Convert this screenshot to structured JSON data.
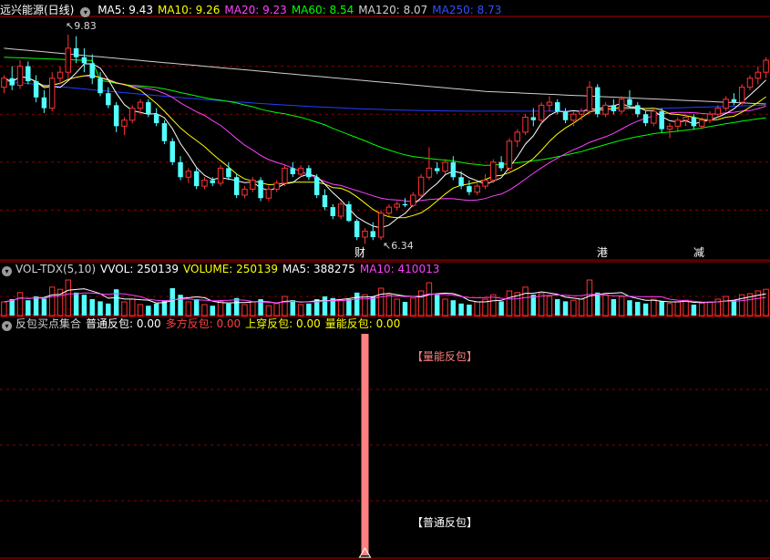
{
  "main_header": {
    "stock_title": "远兴能源(日线)",
    "indicators": [
      {
        "label": "MA5: 9.43",
        "color": "#ffffff"
      },
      {
        "label": "MA10: 9.26",
        "color": "#ffff00"
      },
      {
        "label": "MA20: 9.23",
        "color": "#ff40ff"
      },
      {
        "label": "MA60: 8.54",
        "color": "#00ff00"
      },
      {
        "label": "MA120: 8.07",
        "color": "#d0d0d0"
      },
      {
        "label": "MA250: 8.73",
        "color": "#3050ff"
      }
    ]
  },
  "vol_header": {
    "indicators": [
      {
        "label": "VOL-TDX(5,10)",
        "color": "#d0d0d0"
      },
      {
        "label": "VVOL: 250139",
        "color": "#ffffff"
      },
      {
        "label": "VOLUME: 250139",
        "color": "#ffff00"
      },
      {
        "label": "MA5: 388275",
        "color": "#ffffff"
      },
      {
        "label": "MA10: 410013",
        "color": "#ff40ff"
      }
    ]
  },
  "sub_header": {
    "indicators": [
      {
        "label": "反包买点集合",
        "color": "#d0d0d0"
      },
      {
        "label": "普通反包: 0.00",
        "color": "#ffffff"
      },
      {
        "label": "多方反包: 0.00",
        "color": "#ff4040"
      },
      {
        "label": "上穿反包: 0.00",
        "color": "#ffff00"
      },
      {
        "label": "量能反包: 0.00",
        "color": "#ffff00"
      }
    ]
  },
  "annotations": {
    "high_price": "9.83",
    "low_price": "6.34",
    "signal_top": "【量能反包】",
    "signal_bottom": "【普通反包】",
    "events": [
      "财",
      "港",
      "减"
    ]
  },
  "colors": {
    "up": "#ff3232",
    "down": "#54ffff",
    "grid": "#8b0000",
    "ma5": "#ffffff",
    "ma10": "#ffff00",
    "ma20": "#ff40ff",
    "ma60": "#00ff00",
    "ma120": "#d0d0d0",
    "ma250": "#2040ff",
    "signal": "#ff8080"
  },
  "chart_data": {
    "type": "candlestick",
    "ylim": [
      6.1,
      10.1
    ],
    "candles": [
      [
        8.95,
        9.15,
        8.85,
        9.1
      ],
      [
        9.1,
        9.3,
        8.9,
        8.98
      ],
      [
        8.98,
        9.4,
        8.92,
        9.3
      ],
      [
        9.3,
        9.38,
        9.0,
        9.05
      ],
      [
        9.05,
        9.15,
        8.7,
        8.78
      ],
      [
        8.78,
        8.9,
        8.52,
        8.6
      ],
      [
        8.6,
        9.2,
        8.55,
        9.1
      ],
      [
        9.1,
        9.3,
        9.0,
        9.2
      ],
      [
        9.2,
        9.83,
        9.1,
        9.6
      ],
      [
        9.6,
        9.8,
        9.35,
        9.45
      ],
      [
        9.45,
        9.6,
        9.2,
        9.35
      ],
      [
        9.35,
        9.5,
        9.0,
        9.1
      ],
      [
        9.1,
        9.2,
        8.8,
        8.85
      ],
      [
        8.85,
        8.95,
        8.6,
        8.65
      ],
      [
        8.65,
        8.7,
        8.2,
        8.3
      ],
      [
        8.3,
        8.45,
        8.15,
        8.4
      ],
      [
        8.4,
        8.65,
        8.35,
        8.6
      ],
      [
        8.6,
        8.75,
        8.5,
        8.7
      ],
      [
        8.7,
        8.75,
        8.45,
        8.5
      ],
      [
        8.5,
        8.6,
        8.3,
        8.35
      ],
      [
        8.35,
        8.4,
        8.0,
        8.05
      ],
      [
        8.05,
        8.1,
        7.65,
        7.7
      ],
      [
        7.7,
        7.8,
        7.4,
        7.45
      ],
      [
        7.45,
        7.6,
        7.35,
        7.55
      ],
      [
        7.55,
        7.6,
        7.25,
        7.3
      ],
      [
        7.3,
        7.45,
        7.25,
        7.4
      ],
      [
        7.4,
        7.45,
        7.3,
        7.35
      ],
      [
        7.35,
        7.65,
        7.3,
        7.6
      ],
      [
        7.6,
        7.7,
        7.4,
        7.45
      ],
      [
        7.45,
        7.5,
        7.1,
        7.15
      ],
      [
        7.15,
        7.3,
        7.1,
        7.25
      ],
      [
        7.25,
        7.45,
        7.2,
        7.4
      ],
      [
        7.4,
        7.45,
        7.05,
        7.1
      ],
      [
        7.1,
        7.3,
        7.05,
        7.25
      ],
      [
        7.25,
        7.4,
        7.2,
        7.35
      ],
      [
        7.35,
        7.65,
        7.3,
        7.6
      ],
      [
        7.6,
        7.7,
        7.45,
        7.5
      ],
      [
        7.5,
        7.65,
        7.45,
        7.6
      ],
      [
        7.6,
        7.65,
        7.4,
        7.45
      ],
      [
        7.45,
        7.5,
        7.1,
        7.15
      ],
      [
        7.15,
        7.25,
        6.9,
        6.95
      ],
      [
        6.95,
        7.0,
        6.75,
        6.8
      ],
      [
        6.8,
        7.05,
        6.75,
        7.0
      ],
      [
        7.0,
        7.05,
        6.7,
        6.72
      ],
      [
        6.72,
        6.75,
        6.4,
        6.45
      ],
      [
        6.45,
        6.6,
        6.34,
        6.55
      ],
      [
        6.55,
        6.7,
        6.4,
        6.45
      ],
      [
        6.45,
        6.9,
        6.4,
        6.85
      ],
      [
        6.85,
        7.0,
        6.8,
        6.95
      ],
      [
        6.95,
        7.05,
        6.9,
        7.0
      ],
      [
        7.0,
        7.1,
        6.95,
        6.98
      ],
      [
        6.98,
        7.2,
        6.95,
        7.15
      ],
      [
        7.15,
        7.5,
        7.1,
        7.45
      ],
      [
        7.45,
        7.95,
        7.4,
        7.6
      ],
      [
        7.6,
        7.7,
        7.5,
        7.55
      ],
      [
        7.55,
        7.75,
        7.5,
        7.7
      ],
      [
        7.7,
        7.8,
        7.4,
        7.45
      ],
      [
        7.45,
        7.55,
        7.25,
        7.3
      ],
      [
        7.3,
        7.4,
        7.15,
        7.2
      ],
      [
        7.2,
        7.35,
        7.15,
        7.3
      ],
      [
        7.3,
        7.5,
        7.25,
        7.4
      ],
      [
        7.4,
        7.75,
        7.35,
        7.7
      ],
      [
        7.7,
        7.8,
        7.55,
        7.6
      ],
      [
        7.6,
        8.1,
        7.55,
        8.05
      ],
      [
        8.05,
        8.25,
        7.95,
        8.2
      ],
      [
        8.2,
        8.5,
        8.15,
        8.45
      ],
      [
        8.45,
        8.6,
        8.3,
        8.4
      ],
      [
        8.4,
        8.7,
        8.35,
        8.65
      ],
      [
        8.65,
        8.8,
        8.55,
        8.7
      ],
      [
        8.7,
        8.75,
        8.5,
        8.55
      ],
      [
        8.55,
        8.6,
        8.35,
        8.4
      ],
      [
        8.4,
        8.55,
        8.3,
        8.5
      ],
      [
        8.5,
        8.6,
        8.4,
        8.55
      ],
      [
        8.55,
        9.05,
        8.5,
        8.95
      ],
      [
        8.95,
        9.0,
        8.45,
        8.5
      ],
      [
        8.5,
        8.7,
        8.45,
        8.65
      ],
      [
        8.65,
        8.75,
        8.5,
        8.55
      ],
      [
        8.55,
        8.8,
        8.5,
        8.75
      ],
      [
        8.75,
        8.9,
        8.6,
        8.65
      ],
      [
        8.65,
        8.7,
        8.45,
        8.5
      ],
      [
        8.5,
        8.55,
        8.3,
        8.35
      ],
      [
        8.35,
        8.6,
        8.3,
        8.55
      ],
      [
        8.55,
        8.6,
        8.2,
        8.25
      ],
      [
        8.25,
        8.35,
        8.1,
        8.3
      ],
      [
        8.3,
        8.45,
        8.2,
        8.4
      ],
      [
        8.4,
        8.5,
        8.3,
        8.45
      ],
      [
        8.45,
        8.5,
        8.25,
        8.3
      ],
      [
        8.3,
        8.45,
        8.25,
        8.4
      ],
      [
        8.4,
        8.55,
        8.35,
        8.5
      ],
      [
        8.5,
        8.65,
        8.45,
        8.6
      ],
      [
        8.6,
        8.8,
        8.55,
        8.75
      ],
      [
        8.75,
        8.85,
        8.65,
        8.7
      ],
      [
        8.7,
        9.0,
        8.65,
        8.95
      ],
      [
        8.95,
        9.15,
        8.9,
        9.1
      ],
      [
        9.1,
        9.3,
        9.0,
        9.2
      ],
      [
        9.2,
        9.45,
        9.1,
        9.4
      ]
    ],
    "volumes": [
      250000,
      300000,
      420000,
      280000,
      350000,
      310000,
      520000,
      480000,
      650000,
      420000,
      380000,
      300000,
      260000,
      220000,
      480000,
      250000,
      300000,
      200000,
      180000,
      220000,
      280000,
      500000,
      380000,
      250000,
      300000,
      200000,
      180000,
      260000,
      220000,
      320000,
      200000,
      250000,
      300000,
      180000,
      220000,
      350000,
      280000,
      200000,
      220000,
      300000,
      350000,
      320000,
      280000,
      300000,
      420000,
      380000,
      350000,
      500000,
      380000,
      300000,
      250000,
      320000,
      450000,
      600000,
      380000,
      300000,
      280000,
      220000,
      200000,
      250000,
      300000,
      380000,
      260000,
      450000,
      420000,
      520000,
      380000,
      400000,
      350000,
      300000,
      260000,
      280000,
      300000,
      650000,
      420000,
      380000,
      300000,
      350000,
      280000,
      250000,
      220000,
      300000,
      260000,
      220000,
      250000,
      280000,
      200000,
      230000,
      250000,
      300000,
      350000,
      280000,
      380000,
      400000,
      450000,
      480000
    ],
    "subchart": {
      "type": "signal",
      "signal_index": 45,
      "values": {
        "普通反包": 0.0,
        "多方反包": 0.0,
        "上穿反包": 0.0,
        "量能反包": 0.0
      }
    }
  }
}
